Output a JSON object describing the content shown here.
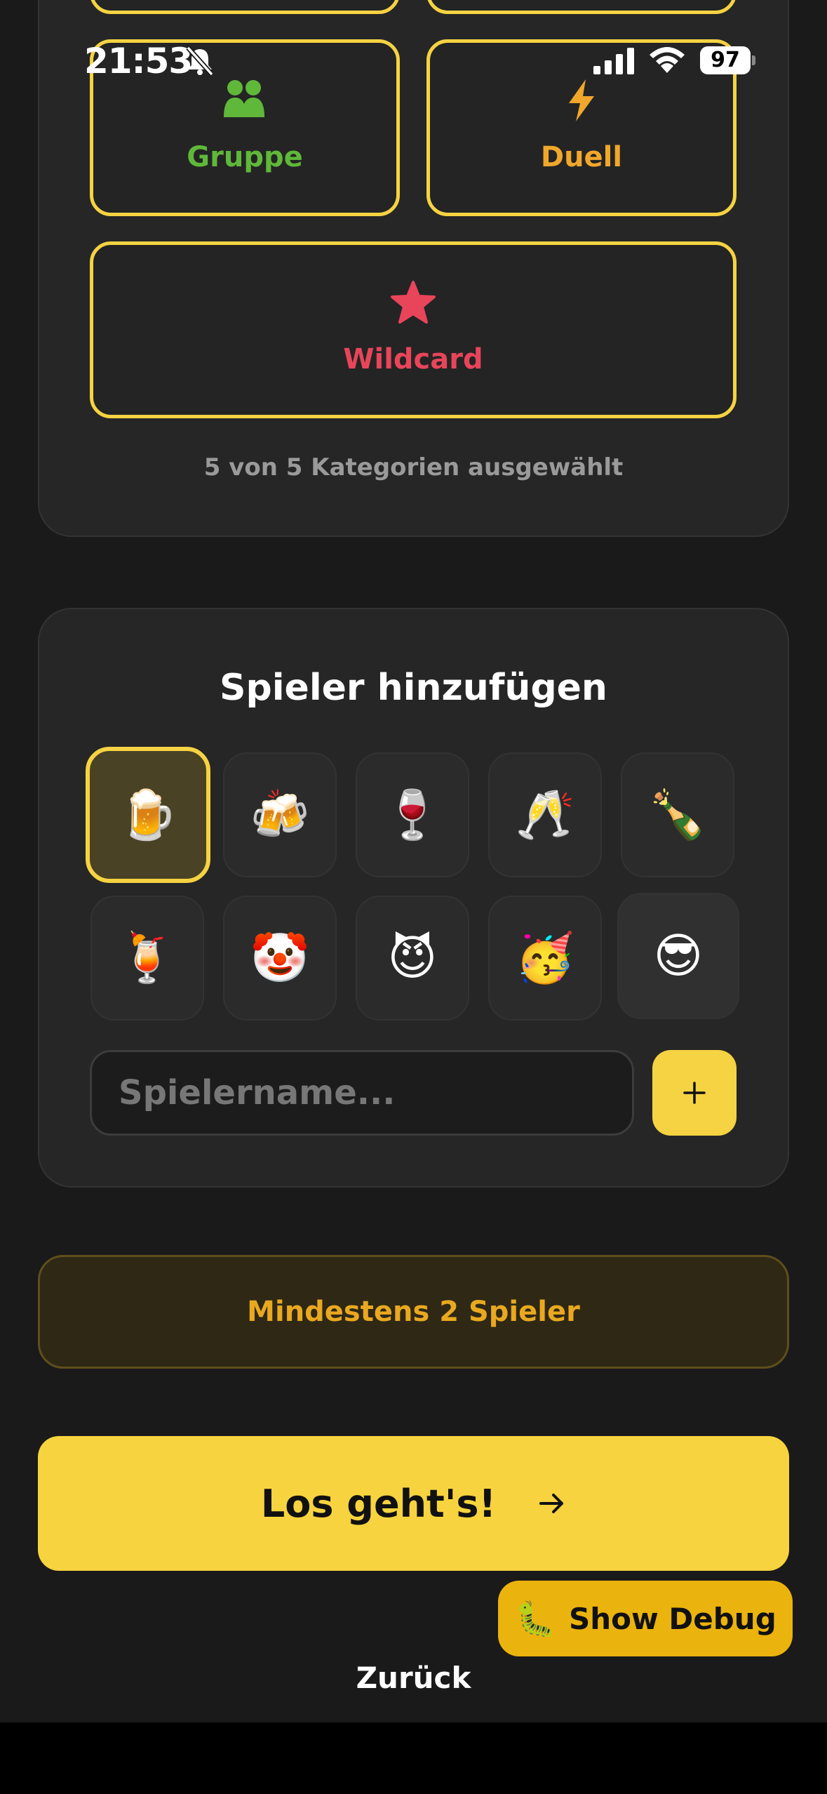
{
  "status_bar": {
    "time": "21:53",
    "battery": "97"
  },
  "categories": {
    "items": [
      {
        "label": "Gruppe",
        "icon": "group-icon",
        "color": "#5fb83a"
      },
      {
        "label": "Duell",
        "icon": "lightning-icon",
        "color": "#f0a72b"
      },
      {
        "label": "Wildcard",
        "icon": "star-icon",
        "color": "#e8455a"
      }
    ],
    "count_text": "5 von 5 Kategorien ausgewählt",
    "border_color": "#f5d342"
  },
  "players": {
    "title": "Spieler hinzufügen",
    "avatars": [
      "🍺",
      "🍻",
      "🍷",
      "🥂",
      "🍾",
      "🍹",
      "🤡",
      "😈",
      "🥳",
      "😎"
    ],
    "selected_index": 0,
    "input_placeholder": "Spielername...",
    "input_value": "",
    "add_icon": "plus-icon"
  },
  "warning": {
    "text": "Mindestens 2 Spieler"
  },
  "start_button": {
    "label": "Los geht's!",
    "icon": "arrow-right-icon"
  },
  "debug_button": {
    "emoji": "🐛",
    "label": "Show Debug"
  },
  "back_link": {
    "label": "Zurück"
  },
  "colors": {
    "accent": "#f5d342",
    "background": "#1a1a1a",
    "card": "#262626",
    "warning_text": "#e9a81f"
  }
}
